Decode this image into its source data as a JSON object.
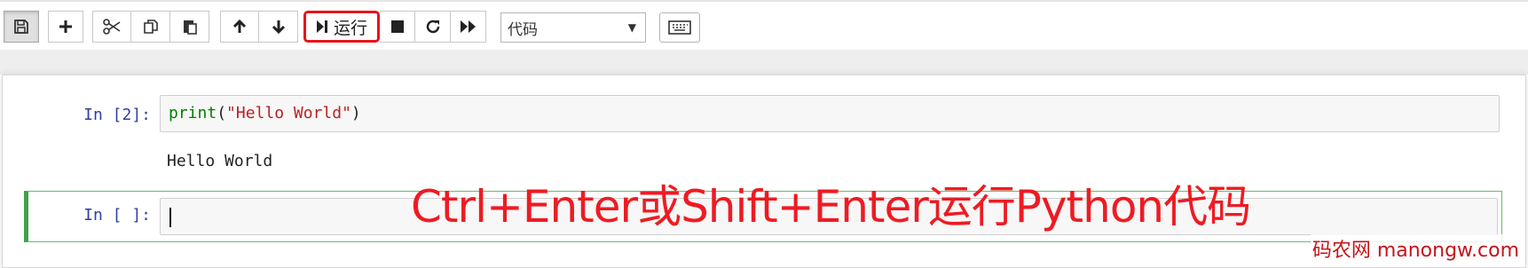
{
  "toolbar": {
    "run_label": "运行",
    "cell_type": "代码"
  },
  "cells": [
    {
      "prompt": "In [2]:",
      "code": {
        "fn": "print",
        "open": "(",
        "arg": "\"Hello World\"",
        "close": ")"
      },
      "output": "Hello World"
    },
    {
      "prompt": "In [ ]:",
      "code": ""
    }
  ],
  "annotation": "Ctrl+Enter或Shift+Enter运行Python代码",
  "watermark": "码农网 manongw.com",
  "colors": {
    "highlight": "#e8141a",
    "selected_cell": "#42a047",
    "prompt": "#303f9f"
  }
}
